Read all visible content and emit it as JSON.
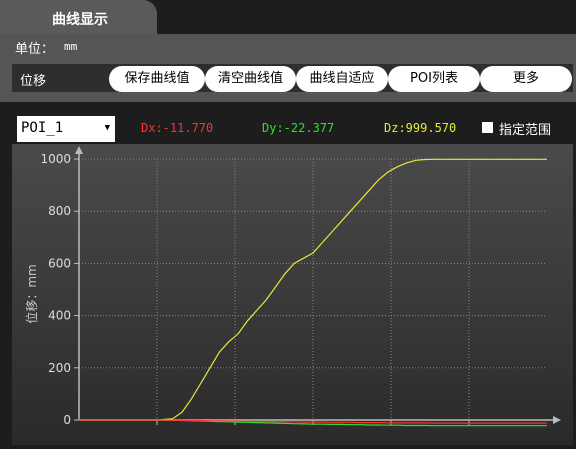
{
  "tab": {
    "title": "曲线显示"
  },
  "unit": {
    "label": "单位：",
    "value": "mm"
  },
  "toolbar": {
    "mode_label": "位移",
    "buttons": [
      "保存曲线值",
      "清空曲线值",
      "曲线自适应",
      "POI列表",
      "更多"
    ]
  },
  "poi": {
    "selected": "POI_1"
  },
  "readout": {
    "dx": "Dx:-11.770",
    "dy": "Dy:-22.377",
    "dz": "Dz:999.570"
  },
  "range": {
    "label": "指定范围",
    "checked": false
  },
  "colors": {
    "dx": "#ff3030",
    "dy": "#30e030",
    "dz": "#e8e83a"
  },
  "chart_data": {
    "type": "line",
    "ylabel": "位移：mm",
    "ylim": [
      0,
      1000
    ],
    "yticks": [
      0,
      200,
      400,
      600,
      800,
      1000
    ],
    "x": [
      0,
      5,
      10,
      15,
      17,
      20,
      22,
      24,
      26,
      28,
      30,
      32,
      34,
      36,
      38,
      40,
      42,
      44,
      46,
      48,
      50,
      52,
      54,
      56,
      58,
      60,
      62,
      64,
      66,
      68,
      70,
      72,
      74,
      76,
      78,
      80,
      82,
      84,
      86,
      88,
      90,
      92,
      94,
      96,
      98,
      100
    ],
    "series": [
      {
        "key": "dz",
        "values": [
          0,
          0,
          0,
          0,
          0,
          5,
          30,
          80,
          140,
          200,
          260,
          300,
          330,
          380,
          420,
          460,
          510,
          560,
          600,
          620,
          640,
          680,
          720,
          760,
          800,
          840,
          880,
          920,
          950,
          970,
          985,
          995,
          998,
          999,
          999,
          999,
          999,
          999,
          999,
          999,
          999,
          999,
          999,
          999,
          999,
          999
        ]
      },
      {
        "key": "dy",
        "values": [
          0,
          0,
          0,
          0,
          0,
          -1,
          -2,
          -3,
          -4,
          -5,
          -6,
          -7,
          -8,
          -9,
          -10,
          -11,
          -12,
          -13,
          -14,
          -15,
          -16,
          -16,
          -17,
          -17,
          -18,
          -18,
          -19,
          -19,
          -20,
          -20,
          -21,
          -21,
          -21,
          -22,
          -22,
          -22,
          -22,
          -22,
          -22,
          -22,
          -22,
          -22,
          -22,
          -22,
          -22,
          -22
        ]
      },
      {
        "key": "dx",
        "values": [
          0,
          0,
          0,
          0,
          0,
          -1,
          -1,
          -2,
          -2,
          -3,
          -3,
          -4,
          -4,
          -5,
          -5,
          -6,
          -6,
          -7,
          -7,
          -8,
          -8,
          -8,
          -9,
          -9,
          -9,
          -10,
          -10,
          -10,
          -11,
          -11,
          -11,
          -11,
          -11,
          -12,
          -12,
          -12,
          -12,
          -12,
          -12,
          -12,
          -12,
          -12,
          -12,
          -12,
          -12,
          -12
        ]
      }
    ]
  }
}
